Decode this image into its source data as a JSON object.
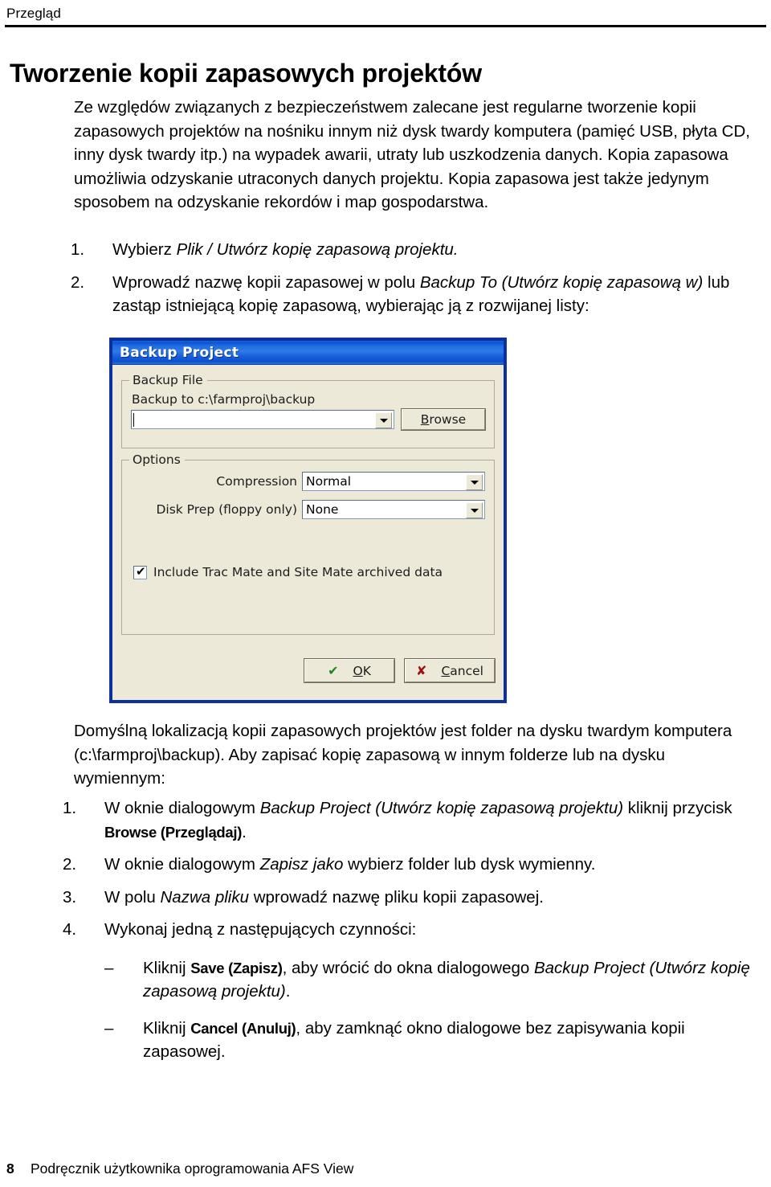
{
  "header": {
    "running_head": "Przegląd"
  },
  "page_title": "Tworzenie kopii zapasowych projektów",
  "intro_paragraph": "Ze względów związanych z bezpieczeństwem zalecane jest regularne tworzenie kopii zapasowych projektów na nośniku innym niż dysk twardy komputera (pamięć USB, płyta CD, inny dysk twardy itp.) na wypadek awarii, utraty lub uszkodzenia danych. Kopia zapasowa umożliwia odzyskanie utraconych danych projektu. Kopia zapasowa jest także jedynym sposobem na odzyskanie rekordów i map gospodarstwa.",
  "steps_upper": [
    {
      "marker": "1.",
      "parts": [
        {
          "text": "Wybierz ",
          "style": "normal"
        },
        {
          "text": "Plik / Utwórz kopię zapasową projektu.",
          "style": "italic"
        }
      ]
    },
    {
      "marker": "2.",
      "parts": [
        {
          "text": "Wprowadź nazwę kopii zapasowej w polu ",
          "style": "normal"
        },
        {
          "text": "Backup To (Utwórz kopię zapasową w)",
          "style": "italic"
        },
        {
          "text": " lub zastąp istniejącą kopię zapasową, wybierając ją z rozwijanej listy:",
          "style": "normal"
        }
      ]
    }
  ],
  "dialog": {
    "title": "Backup Project",
    "groups": {
      "backup_file": {
        "legend": "Backup File",
        "path_label": "Backup to c:\\farmproj\\backup",
        "path_value": "",
        "browse_button": "Browse",
        "browse_accesskey": "B"
      },
      "options": {
        "legend": "Options",
        "compression": {
          "label": "Compression",
          "value": "Normal"
        },
        "disk_prep": {
          "label": "Disk Prep (floppy only)",
          "value": "None"
        },
        "checkbox": {
          "label": "Include Trac Mate and Site Mate archived data",
          "checked": true,
          "tick_glyph": "✔"
        }
      }
    },
    "buttons": {
      "ok": {
        "label_pre": "O",
        "label_post": "K",
        "glyph": "✔",
        "glyph_color": "#1a8a1a"
      },
      "cancel": {
        "label_pre": "C",
        "label_post": "ancel",
        "glyph": "✘",
        "glyph_color": "#9b1111"
      }
    },
    "colors": {
      "titlebar_blue": "#1f6ae0",
      "window_frame": "#0a2f9e",
      "face": "#ece9d8"
    }
  },
  "default_location_paragraph": "Domyślną lokalizacją kopii zapasowych projektów jest folder na dysku twardym komputera (c:\\farmproj\\backup). Aby zapisać kopię zapasową w innym folderze lub na dysku wymiennym:",
  "steps_lower": [
    {
      "marker": "1.",
      "parts": [
        {
          "text": "W oknie dialogowym ",
          "style": "normal"
        },
        {
          "text": "Backup Project (Utwórz kopię zapasową projektu)",
          "style": "italic"
        },
        {
          "text": " kliknij przycisk ",
          "style": "normal"
        },
        {
          "text": "Browse (Przeglądaj)",
          "style": "bold"
        },
        {
          "text": ".",
          "style": "normal"
        }
      ]
    },
    {
      "marker": "2.",
      "parts": [
        {
          "text": "W oknie dialogowym ",
          "style": "normal"
        },
        {
          "text": "Zapisz jako",
          "style": "italic"
        },
        {
          "text": " wybierz folder lub dysk wymienny.",
          "style": "normal"
        }
      ]
    },
    {
      "marker": "3.",
      "parts": [
        {
          "text": "W polu ",
          "style": "normal"
        },
        {
          "text": "Nazwa pliku",
          "style": "italic"
        },
        {
          "text": " wprowadź nazwę pliku kopii zapasowej.",
          "style": "normal"
        }
      ]
    },
    {
      "marker": "4.",
      "parts": [
        {
          "text": "Wykonaj jedną z następujących czynności:",
          "style": "normal"
        }
      ],
      "sub_items": [
        {
          "marker": "–",
          "parts": [
            {
              "text": "Kliknij ",
              "style": "normal"
            },
            {
              "text": "Save (Zapisz)",
              "style": "bold"
            },
            {
              "text": ", aby wrócić do okna dialogowego ",
              "style": "normal"
            },
            {
              "text": "Backup Project (Utwórz kopię zapasową projektu)",
              "style": "italic"
            },
            {
              "text": ".",
              "style": "normal"
            }
          ]
        },
        {
          "marker": "–",
          "parts": [
            {
              "text": "Kliknij ",
              "style": "normal"
            },
            {
              "text": "Cancel (Anuluj)",
              "style": "bold"
            },
            {
              "text": ", aby zamknąć okno dialogowe bez zapisywania kopii zapasowej.",
              "style": "normal"
            }
          ]
        }
      ]
    }
  ],
  "footer": {
    "page_number": "8",
    "document_title": "Podręcznik użytkownika oprogramowania AFS View"
  }
}
